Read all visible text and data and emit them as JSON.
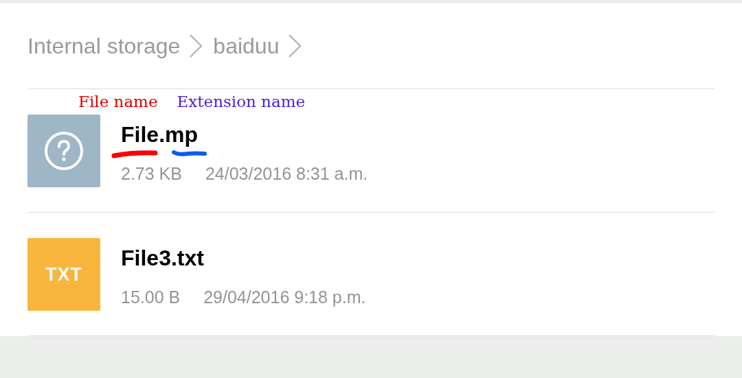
{
  "breadcrumb": [
    {
      "label": "Internal storage"
    },
    {
      "label": "baiduu"
    }
  ],
  "annotations": [
    {
      "text": "File name",
      "color": "#e00000"
    },
    {
      "text": "Extension name",
      "color": "#4a1fe0"
    }
  ],
  "files": [
    {
      "name": "File.mp",
      "size": "2.73 KB",
      "modified": "24/03/2016 8:31 a.m.",
      "kind": "unknown"
    },
    {
      "name": "File3.txt",
      "size": "15.00 B",
      "modified": "29/04/2016 9:18 p.m.",
      "kind": "text",
      "badge": "TXT"
    }
  ]
}
